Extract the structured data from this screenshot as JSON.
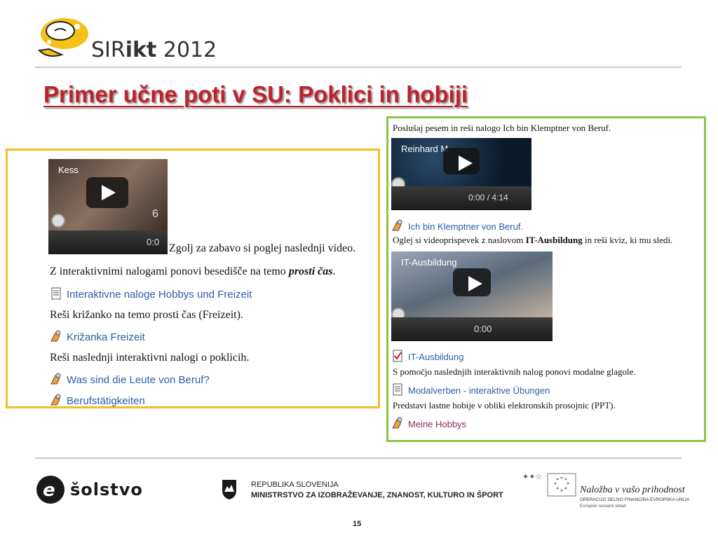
{
  "header": {
    "logo_text_plain": "SIR",
    "logo_text_bold": "ikt",
    "logo_year": " 2012"
  },
  "slide": {
    "title": "Primer učne poti v SU: Poklici in hobiji",
    "page_number": "15"
  },
  "left_panel": {
    "video": {
      "label": "Kess",
      "time": "0:0",
      "digit": "6"
    },
    "items": [
      {
        "kind": "text",
        "text": "Zgolj za zabavo si poglej naslednji video."
      },
      {
        "kind": "text_em",
        "text": "Z interaktivnimi nalogami ponovi besedišče na temo ",
        "emphasis": "prosti čas",
        "tail": "."
      },
      {
        "kind": "link",
        "icon": "document-icon",
        "text": "Interaktivne naloge Hobbys und Freizeit"
      },
      {
        "kind": "text",
        "text": "Reši križanko na temo prosti čas (Freizeit)."
      },
      {
        "kind": "link",
        "icon": "puzzle-icon",
        "text": "Križanka Freizeit"
      },
      {
        "kind": "text",
        "text": "Reši naslednji interaktivni nalogi o poklicih."
      },
      {
        "kind": "link",
        "icon": "puzzle-icon",
        "text": "Was sind die Leute von Beruf?"
      },
      {
        "kind": "link",
        "icon": "puzzle-icon",
        "text": "Berufstätigkeiten"
      }
    ]
  },
  "right_panel": {
    "intro": "Poslušaj pesem in reši nalogo Ich bin Klemptner von Beruf.",
    "video1": {
      "label": "Reinhard M",
      "time": "0:00 / 4:14"
    },
    "link1": "Ich bin Klemptner von Beruf.",
    "text2_pre": "Oglej si videoprispevek z naslovom ",
    "text2_bold": "IT-Ausbildung",
    "text2_post": " in reši kviz, ki mu sledi.",
    "video2": {
      "label": "IT-Ausbildung",
      "time": "0:00"
    },
    "link2": "IT-Ausbildung",
    "text3": "S pomočjo naslednjih interaktivnih nalog ponovi modalne glagole.",
    "link3": "Modalverben - interaktive Übungen",
    "text4": "Predstavi lastne hobije v obliki elektronskih prosojnic (PPT).",
    "link4": "Meine Hobbys"
  },
  "footer": {
    "solstvo": "šolstvo",
    "ministry_line1": "REPUBLIKA SLOVENIJA",
    "ministry_line2": "MINISTRSTVO ZA IZOBRAŽEVANJE, ZNANOST, KULTURO IN ŠPORT",
    "eu_title": "Naložba v vašo prihodnost",
    "eu_sub1": "OPERACIJO DELNO FINANCIRA EVROPSKA UNIJA",
    "eu_sub2": "Evropski socialni sklad"
  },
  "colors": {
    "title": "#c0222c",
    "left_border": "#f4bd25",
    "right_border": "#8bc34a",
    "link": "#2c5ea8"
  }
}
